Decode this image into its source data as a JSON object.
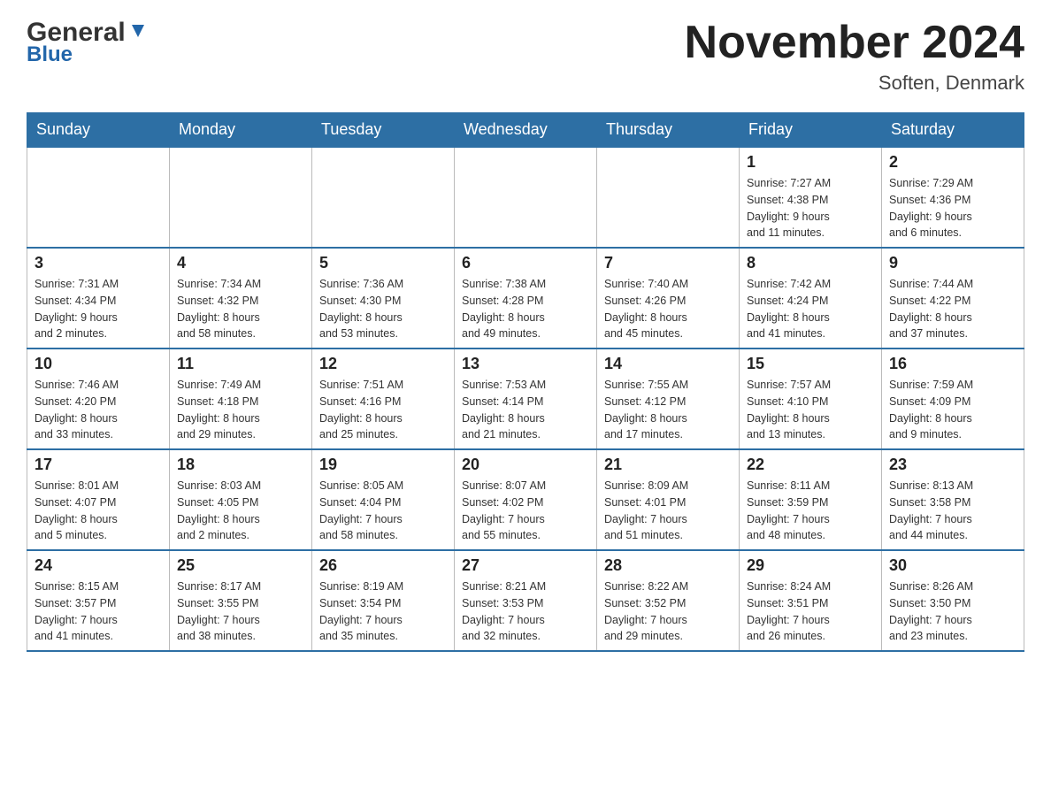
{
  "header": {
    "logo_general": "General",
    "logo_blue": "Blue",
    "month_title": "November 2024",
    "location": "Soften, Denmark"
  },
  "weekdays": [
    "Sunday",
    "Monday",
    "Tuesday",
    "Wednesday",
    "Thursday",
    "Friday",
    "Saturday"
  ],
  "weeks": [
    [
      {
        "day": "",
        "info": ""
      },
      {
        "day": "",
        "info": ""
      },
      {
        "day": "",
        "info": ""
      },
      {
        "day": "",
        "info": ""
      },
      {
        "day": "",
        "info": ""
      },
      {
        "day": "1",
        "info": "Sunrise: 7:27 AM\nSunset: 4:38 PM\nDaylight: 9 hours\nand 11 minutes."
      },
      {
        "day": "2",
        "info": "Sunrise: 7:29 AM\nSunset: 4:36 PM\nDaylight: 9 hours\nand 6 minutes."
      }
    ],
    [
      {
        "day": "3",
        "info": "Sunrise: 7:31 AM\nSunset: 4:34 PM\nDaylight: 9 hours\nand 2 minutes."
      },
      {
        "day": "4",
        "info": "Sunrise: 7:34 AM\nSunset: 4:32 PM\nDaylight: 8 hours\nand 58 minutes."
      },
      {
        "day": "5",
        "info": "Sunrise: 7:36 AM\nSunset: 4:30 PM\nDaylight: 8 hours\nand 53 minutes."
      },
      {
        "day": "6",
        "info": "Sunrise: 7:38 AM\nSunset: 4:28 PM\nDaylight: 8 hours\nand 49 minutes."
      },
      {
        "day": "7",
        "info": "Sunrise: 7:40 AM\nSunset: 4:26 PM\nDaylight: 8 hours\nand 45 minutes."
      },
      {
        "day": "8",
        "info": "Sunrise: 7:42 AM\nSunset: 4:24 PM\nDaylight: 8 hours\nand 41 minutes."
      },
      {
        "day": "9",
        "info": "Sunrise: 7:44 AM\nSunset: 4:22 PM\nDaylight: 8 hours\nand 37 minutes."
      }
    ],
    [
      {
        "day": "10",
        "info": "Sunrise: 7:46 AM\nSunset: 4:20 PM\nDaylight: 8 hours\nand 33 minutes."
      },
      {
        "day": "11",
        "info": "Sunrise: 7:49 AM\nSunset: 4:18 PM\nDaylight: 8 hours\nand 29 minutes."
      },
      {
        "day": "12",
        "info": "Sunrise: 7:51 AM\nSunset: 4:16 PM\nDaylight: 8 hours\nand 25 minutes."
      },
      {
        "day": "13",
        "info": "Sunrise: 7:53 AM\nSunset: 4:14 PM\nDaylight: 8 hours\nand 21 minutes."
      },
      {
        "day": "14",
        "info": "Sunrise: 7:55 AM\nSunset: 4:12 PM\nDaylight: 8 hours\nand 17 minutes."
      },
      {
        "day": "15",
        "info": "Sunrise: 7:57 AM\nSunset: 4:10 PM\nDaylight: 8 hours\nand 13 minutes."
      },
      {
        "day": "16",
        "info": "Sunrise: 7:59 AM\nSunset: 4:09 PM\nDaylight: 8 hours\nand 9 minutes."
      }
    ],
    [
      {
        "day": "17",
        "info": "Sunrise: 8:01 AM\nSunset: 4:07 PM\nDaylight: 8 hours\nand 5 minutes."
      },
      {
        "day": "18",
        "info": "Sunrise: 8:03 AM\nSunset: 4:05 PM\nDaylight: 8 hours\nand 2 minutes."
      },
      {
        "day": "19",
        "info": "Sunrise: 8:05 AM\nSunset: 4:04 PM\nDaylight: 7 hours\nand 58 minutes."
      },
      {
        "day": "20",
        "info": "Sunrise: 8:07 AM\nSunset: 4:02 PM\nDaylight: 7 hours\nand 55 minutes."
      },
      {
        "day": "21",
        "info": "Sunrise: 8:09 AM\nSunset: 4:01 PM\nDaylight: 7 hours\nand 51 minutes."
      },
      {
        "day": "22",
        "info": "Sunrise: 8:11 AM\nSunset: 3:59 PM\nDaylight: 7 hours\nand 48 minutes."
      },
      {
        "day": "23",
        "info": "Sunrise: 8:13 AM\nSunset: 3:58 PM\nDaylight: 7 hours\nand 44 minutes."
      }
    ],
    [
      {
        "day": "24",
        "info": "Sunrise: 8:15 AM\nSunset: 3:57 PM\nDaylight: 7 hours\nand 41 minutes."
      },
      {
        "day": "25",
        "info": "Sunrise: 8:17 AM\nSunset: 3:55 PM\nDaylight: 7 hours\nand 38 minutes."
      },
      {
        "day": "26",
        "info": "Sunrise: 8:19 AM\nSunset: 3:54 PM\nDaylight: 7 hours\nand 35 minutes."
      },
      {
        "day": "27",
        "info": "Sunrise: 8:21 AM\nSunset: 3:53 PM\nDaylight: 7 hours\nand 32 minutes."
      },
      {
        "day": "28",
        "info": "Sunrise: 8:22 AM\nSunset: 3:52 PM\nDaylight: 7 hours\nand 29 minutes."
      },
      {
        "day": "29",
        "info": "Sunrise: 8:24 AM\nSunset: 3:51 PM\nDaylight: 7 hours\nand 26 minutes."
      },
      {
        "day": "30",
        "info": "Sunrise: 8:26 AM\nSunset: 3:50 PM\nDaylight: 7 hours\nand 23 minutes."
      }
    ]
  ]
}
